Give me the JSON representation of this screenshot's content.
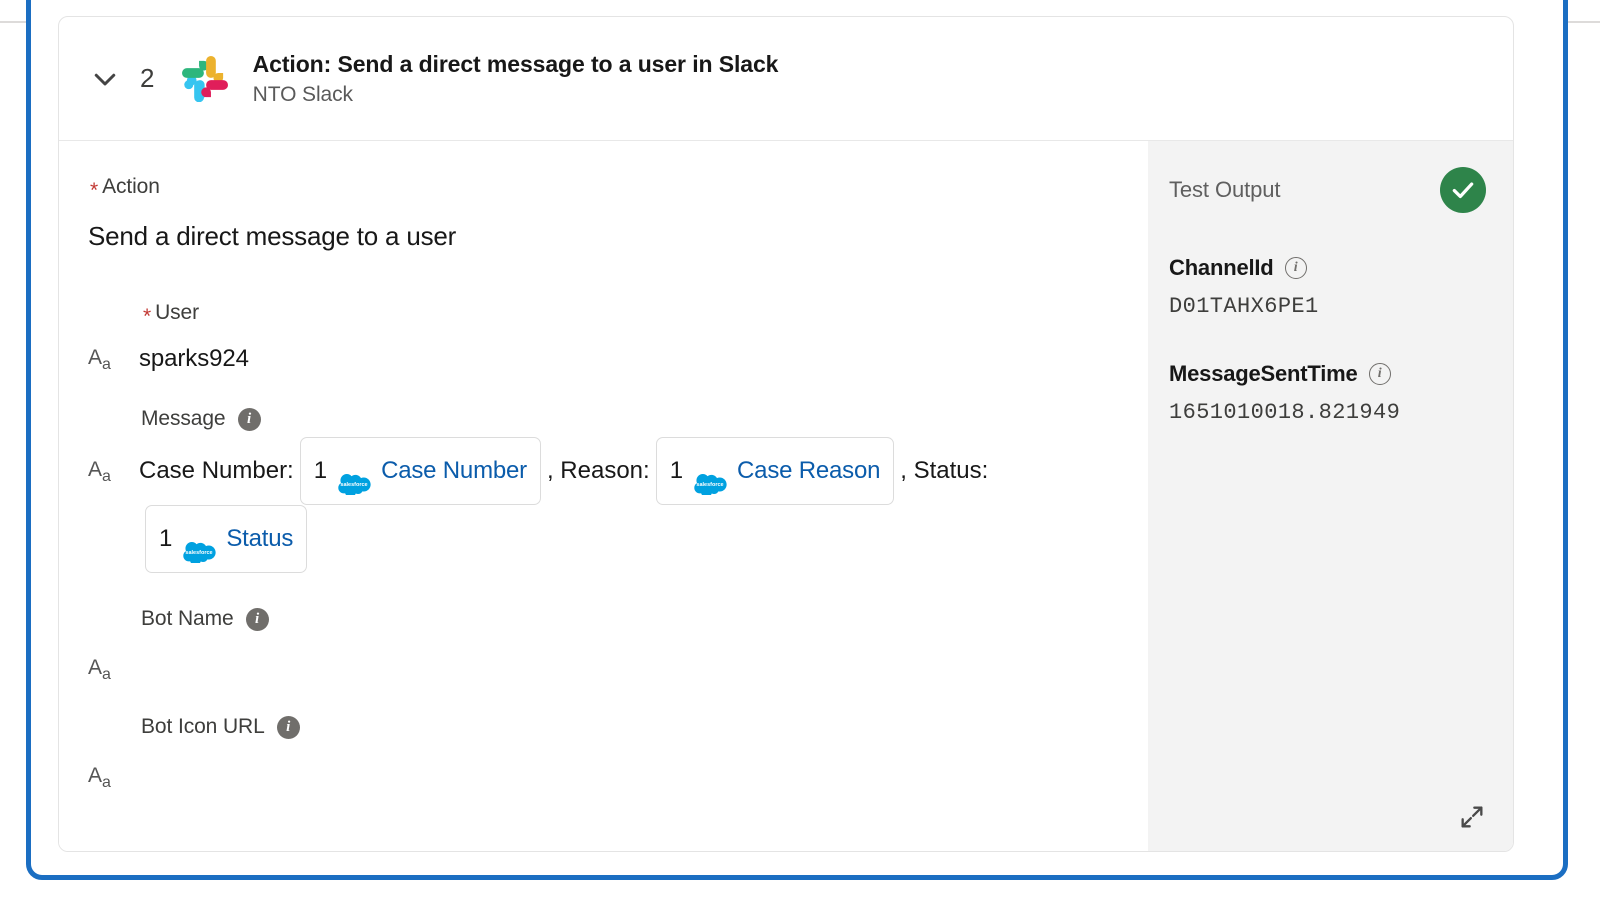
{
  "colors": {
    "selection_border": "#1B6EC2",
    "link_blue": "#0B5CAB",
    "success_green": "#2E844A",
    "required_red": "#C23934",
    "panel_gray": "#F3F3F3",
    "info_gray": "#706E6B",
    "salesforce_cloud": "#00A1E0"
  },
  "header": {
    "collapse_icon": "chevron-down-icon",
    "step_number": "2",
    "app_logo": "slack-logo-icon",
    "title": "Action: Send a direct message to a user in Slack",
    "subtitle": "NTO Slack"
  },
  "form": {
    "action": {
      "required_marker": "*",
      "label": "Action",
      "value": "Send a direct message to a user"
    },
    "user": {
      "required_marker": "*",
      "label": "User",
      "type_icon": "text-type-icon",
      "value": "sparks924"
    },
    "message": {
      "label": "Message",
      "info_icon": "info-icon",
      "type_icon": "text-type-icon",
      "segments": [
        {
          "kind": "text",
          "text": "Case Number:"
        },
        {
          "kind": "chip",
          "num": "1",
          "logo": "salesforce-cloud-icon",
          "label": "Case Number"
        },
        {
          "kind": "text",
          "text": ", Reason:"
        },
        {
          "kind": "chip",
          "num": "1",
          "logo": "salesforce-cloud-icon",
          "label": "Case Reason"
        },
        {
          "kind": "text",
          "text": ", Status:"
        },
        {
          "kind": "chip",
          "num": "1",
          "logo": "salesforce-cloud-icon",
          "label": "Status"
        }
      ]
    },
    "bot_name": {
      "label": "Bot Name",
      "info_icon": "info-icon",
      "type_icon": "text-type-icon",
      "value": ""
    },
    "bot_icon_url": {
      "label": "Bot Icon URL",
      "info_icon": "info-icon",
      "type_icon": "text-type-icon",
      "value": ""
    }
  },
  "test_output": {
    "title": "Test Output",
    "status_icon": "success-check-icon",
    "expand_icon": "expand-diagonal-icon",
    "fields": [
      {
        "label": "ChannelId",
        "info_icon": "info-icon",
        "value": "D01TAHX6PE1"
      },
      {
        "label": "MessageSentTime",
        "info_icon": "info-icon",
        "value": "1651010018.821949"
      }
    ]
  }
}
